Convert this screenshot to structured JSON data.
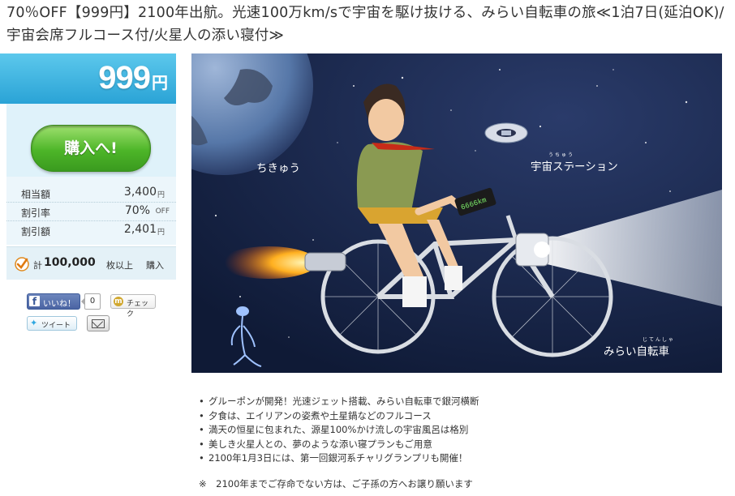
{
  "deal": {
    "title": "70％OFF【999円】2100年出航。光速100万km/sで宇宙を駆け抜ける、みらい自転車の旅≪1泊7日(延泊OK)/宇宙会席フルコース付/火星人の添い寝付≫"
  },
  "price": {
    "value": "999",
    "unit": "円"
  },
  "buy_button": {
    "label": "購入へ!"
  },
  "info": {
    "rows": [
      {
        "label": "相当額",
        "value": "3,400",
        "unit": "円"
      },
      {
        "label": "割引率",
        "value": "70%",
        "unit": "OFF"
      },
      {
        "label": "割引額",
        "value": "2,401",
        "unit": "円"
      }
    ]
  },
  "sold": {
    "prefix": "計",
    "count": "100,000",
    "suffix": "枚以上",
    "action": "購入"
  },
  "social": {
    "like_label": "いいね！",
    "like_count": "0",
    "mixi_label": "チェック",
    "tweet_label": "ツイート"
  },
  "hero": {
    "labels": {
      "earth": "ちきゅう",
      "station": "宇宙ステーション",
      "station_ruby": "うちゅう",
      "bike": "みらい自転車",
      "bike_ruby": "じてんしゃ",
      "speedometer": "6666km"
    }
  },
  "features": [
    "グルーポンが開発！光速ジェット搭載、みらい自転車で銀河横断",
    "夕食は、エイリアンの姿煮や土星鍋などのフルコース",
    "満天の恒星に包まれた、源星100%かけ流しの宇宙風呂は格別",
    "美しき火星人との、夢のような添い寝プランもご用意",
    "2100年1月3日には、第一回銀河系チャリグランプリも開催！"
  ],
  "note": "※　2100年までご存命でない方は、ご子孫の方へお譲り願います",
  "colors": {
    "price_blue": "#2aa3d6",
    "buy_green": "#4db528",
    "space_navy": "#14213f",
    "facebook": "#3b5998"
  }
}
